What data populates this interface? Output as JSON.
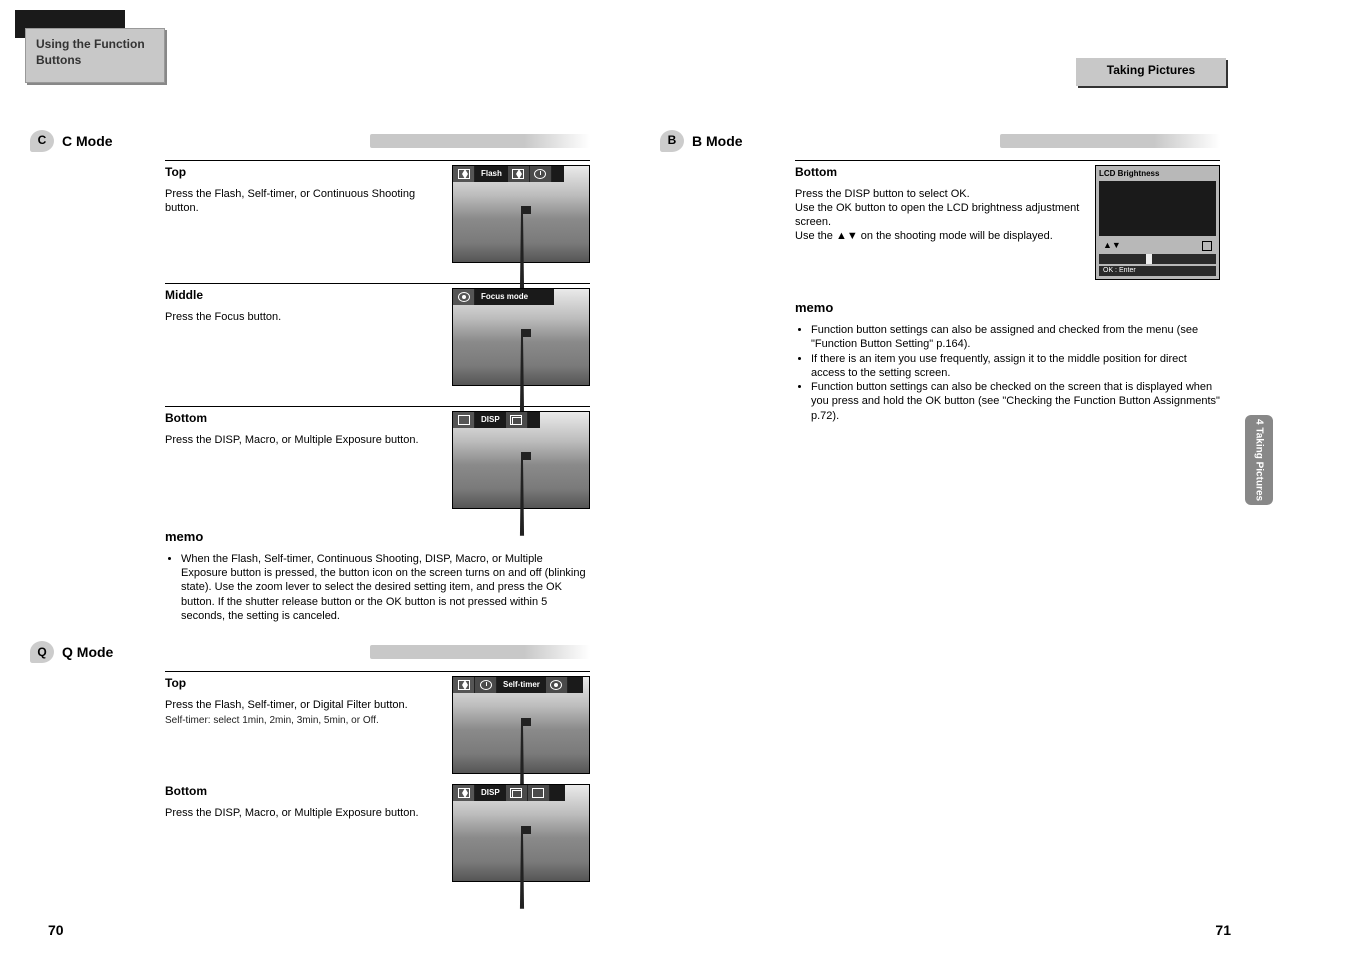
{
  "header": {
    "line1": "Using the Function",
    "line2": "Buttons"
  },
  "top_right_title": "Taking Pictures",
  "side_tab": "4 Taking Pictures",
  "left_sections": [
    {
      "id": "C",
      "label": "C Mode",
      "layers": [
        {
          "title": "Top",
          "text": "Press the Flash, Self-timer, or Continuous Shooting button.",
          "thumb": {
            "segments": [
              {
                "kind": "icon-seg first",
                "icon": "flash"
              },
              {
                "kind": "dark txt",
                "text": "Flash"
              },
              {
                "kind": "icon-seg",
                "icon": "flash"
              },
              {
                "kind": "icon-seg",
                "icon": "timer"
              },
              {
                "kind": "dark txt",
                "text": ""
              }
            ]
          }
        },
        {
          "title": "Middle",
          "text": "Press the Focus button.",
          "thumb": {
            "segments": [
              {
                "kind": "icon-seg first",
                "icon": "eye"
              },
              {
                "kind": "dark txt",
                "text": "Focus mode"
              },
              {
                "kind": "dark txt",
                "text": ""
              }
            ]
          }
        },
        {
          "title": "Bottom",
          "text": "Press the DISP, Macro, or Multiple Exposure button.",
          "thumb": {
            "segments": [
              {
                "kind": "icon-seg first",
                "icon": "rect"
              },
              {
                "kind": "dark txt",
                "text": "DISP"
              },
              {
                "kind": "icon-seg",
                "icon": "cont"
              },
              {
                "kind": "dark txt",
                "text": ""
              }
            ]
          }
        }
      ],
      "memo": {
        "title": "memo",
        "items": [
          "When the Flash, Self-timer, Continuous Shooting, DISP, Macro, or Multiple Exposure button is pressed, the button icon on the screen turns on and off (blinking state). Use the zoom lever to select the desired setting item, and press the OK button. If the shutter release button or the OK button is not pressed within 5 seconds, the setting is canceled."
        ]
      }
    },
    {
      "id": "Q",
      "label": "Q Mode",
      "layers": [
        {
          "title": "Top",
          "text": "Press the Flash, Self-timer, or Digital Filter button.",
          "sub": "Self-timer: select 1min, 2min, 3min, 5min, or Off.",
          "thumb": {
            "segments": [
              {
                "kind": "icon-seg first",
                "icon": "flash"
              },
              {
                "kind": "icon-seg",
                "icon": "timer"
              },
              {
                "kind": "dark txt",
                "text": "Self-timer"
              },
              {
                "kind": "icon-seg",
                "icon": "eye"
              },
              {
                "kind": "dark txt",
                "text": ""
              }
            ]
          }
        },
        {
          "title": "Bottom",
          "text": "Press the DISP, Macro, or Multiple Exposure button.",
          "thumb": {
            "segments": [
              {
                "kind": "icon-seg first",
                "icon": "flash"
              },
              {
                "kind": "dark txt",
                "text": "DISP"
              },
              {
                "kind": "icon-seg",
                "icon": "cont"
              },
              {
                "kind": "icon-seg",
                "icon": "rect"
              },
              {
                "kind": "dark txt",
                "text": ""
              }
            ]
          }
        }
      ]
    }
  ],
  "right_section": {
    "id": "B",
    "label": "B Mode",
    "layers": [
      {
        "title": "Bottom",
        "text_lines": [
          "Press the DISP button to select OK.",
          "Use the OK button to open the LCD brightness adjustment screen.",
          "Use the ▲▼ on the shooting mode will be displayed."
        ],
        "bright_thumb": {
          "title": "LCD Brightness",
          "ok": "OK : Enter",
          "arrows": "▲▼"
        }
      }
    ],
    "memo": {
      "title": "memo",
      "items": [
        "Function button settings can also be assigned and checked from the menu (see \"Function Button Setting\" p.164).",
        "If there is an item you use frequently, assign it to the middle position for direct access to the setting screen.",
        "Function button settings can also be checked on the screen that is displayed when you press and hold the OK button (see \"Checking the Function Button Assignments\" p.72)."
      ]
    }
  },
  "page_numbers": {
    "left": "70",
    "right": "71"
  }
}
